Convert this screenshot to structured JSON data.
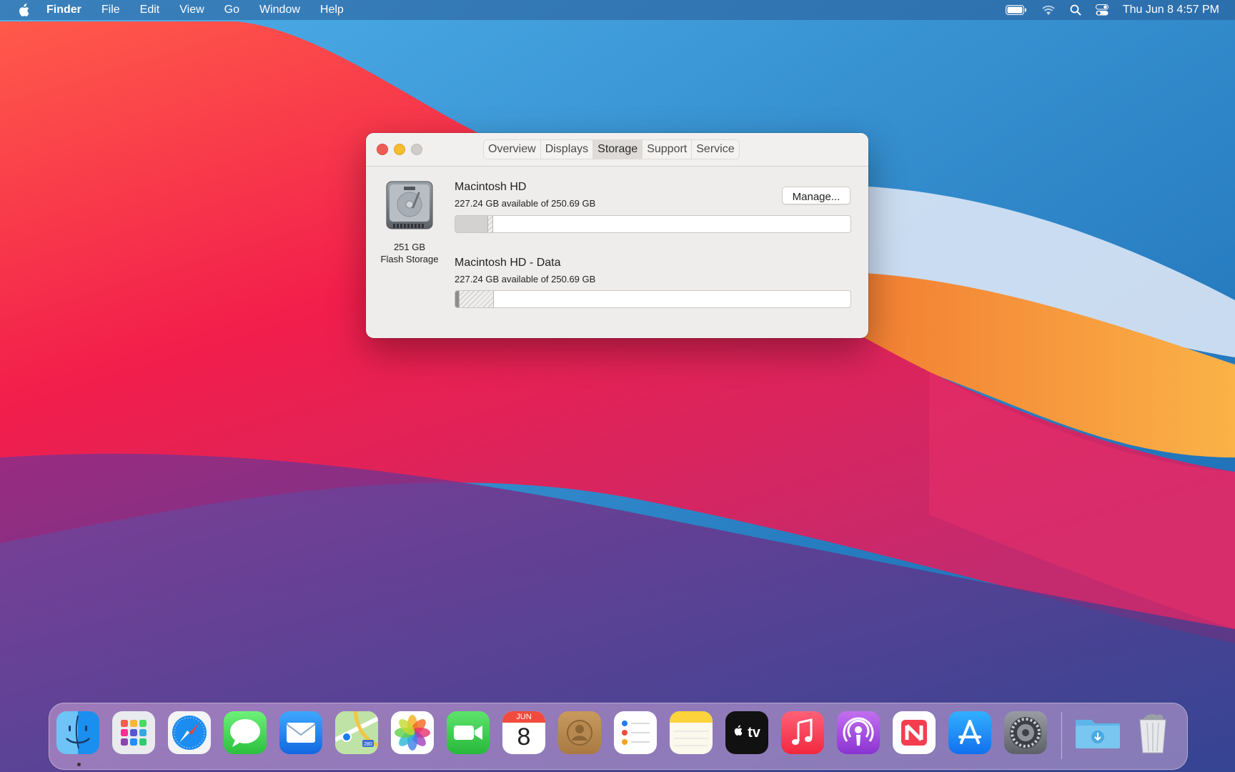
{
  "menubar": {
    "app_name": "Finder",
    "items": [
      "File",
      "Edit",
      "View",
      "Go",
      "Window",
      "Help"
    ],
    "clock": "Thu Jun 8  4:57 PM"
  },
  "window": {
    "tabs": [
      "Overview",
      "Displays",
      "Storage",
      "Support",
      "Service"
    ],
    "active_tab": "Storage",
    "drive": {
      "size": "251 GB",
      "type": "Flash Storage"
    },
    "manage_label": "Manage...",
    "volumes": [
      {
        "name": "Macintosh HD",
        "available": "227.24 GB available of 250.69 GB",
        "used_fraction": 0.094
      },
      {
        "name": "Macintosh HD - Data",
        "available": "227.24 GB available of 250.69 GB",
        "used_fraction": 0.094
      }
    ]
  },
  "dock": {
    "apps": [
      "Finder",
      "Launchpad",
      "Safari",
      "Messages",
      "Mail",
      "Maps",
      "Photos",
      "FaceTime",
      "Calendar",
      "Contacts",
      "Reminders",
      "Notes",
      "TV",
      "Music",
      "Podcasts",
      "News",
      "App Store",
      "System Preferences"
    ],
    "calendar": {
      "month": "JUN",
      "day": "8"
    },
    "tv_label": "tv",
    "maps_badge": "280",
    "extras": [
      "Downloads",
      "Trash"
    ]
  },
  "colors": {
    "close": "#ee5c56",
    "minimize": "#f7bd2f",
    "zoom_disabled": "#cfccca"
  }
}
